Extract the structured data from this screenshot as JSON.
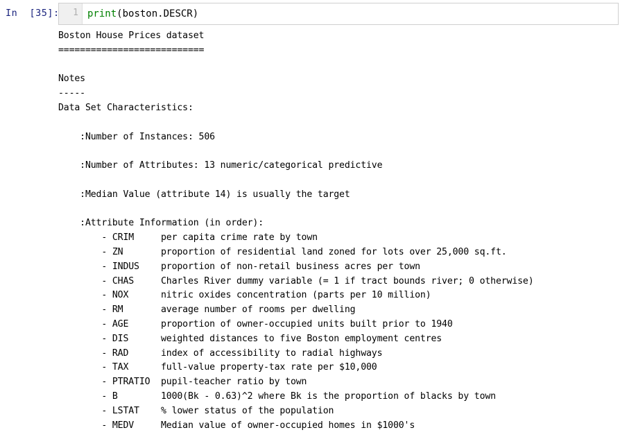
{
  "cell": {
    "prompt_label": "In  [35]:",
    "line_number": "1",
    "code_tokens": {
      "builtin": "print",
      "rest": "(boston.DESCR)"
    },
    "code_full": "print(boston.DESCR)"
  },
  "colors": {
    "prompt": "#1a237e",
    "builtin": "#008000",
    "code_text": "#000000",
    "cell_background": "#f7f7f7",
    "code_background": "#ffffff",
    "gutter_background": "#f0f0f0",
    "gutter_text": "#b0b0b0",
    "output_text": "#000000",
    "page_background": "#ffffff"
  },
  "output": {
    "title": "Boston House Prices dataset",
    "title_underline": "===========================",
    "notes_heading": "Notes",
    "notes_underline": "-----",
    "characteristics_heading": "Data Set Characteristics:",
    "characteristics": [
      ":Number of Instances: 506",
      ":Number of Attributes: 13 numeric/categorical predictive",
      ":Median Value (attribute 14) is usually the target"
    ],
    "attribute_info_heading": ":Attribute Information (in order):",
    "attributes": [
      {
        "name": "CRIM",
        "description": "per capita crime rate by town"
      },
      {
        "name": "ZN",
        "description": "proportion of residential land zoned for lots over 25,000 sq.ft."
      },
      {
        "name": "INDUS",
        "description": "proportion of non-retail business acres per town"
      },
      {
        "name": "CHAS",
        "description": "Charles River dummy variable (= 1 if tract bounds river; 0 otherwise)"
      },
      {
        "name": "NOX",
        "description": "nitric oxides concentration (parts per 10 million)"
      },
      {
        "name": "RM",
        "description": "average number of rooms per dwelling"
      },
      {
        "name": "AGE",
        "description": "proportion of owner-occupied units built prior to 1940"
      },
      {
        "name": "DIS",
        "description": "weighted distances to five Boston employment centres"
      },
      {
        "name": "RAD",
        "description": "index of accessibility to radial highways"
      },
      {
        "name": "TAX",
        "description": "full-value property-tax rate per $10,000"
      },
      {
        "name": "PTRATIO",
        "description": "pupil-teacher ratio by town"
      },
      {
        "name": "B",
        "description": "1000(Bk - 0.63)^2 where Bk is the proportion of blacks by town"
      },
      {
        "name": "LSTAT",
        "description": "% lower status of the population"
      },
      {
        "name": "MEDV",
        "description": "Median value of owner-occupied homes in $1000's"
      }
    ],
    "full_text": ""
  }
}
